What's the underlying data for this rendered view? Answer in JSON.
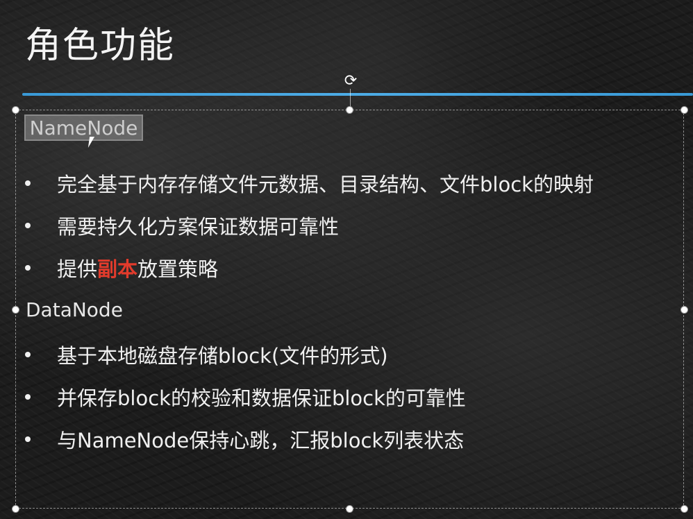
{
  "slide": {
    "title": "角色功能",
    "accent_color": "#4fb3f0",
    "highlight_color": "#e23b2c"
  },
  "namenode": {
    "heading": "NameNode",
    "bullets": [
      {
        "text": "完全基于内存存储文件元数据、目录结构、文件block的映射"
      },
      {
        "text": "需要持久化方案保证数据可靠性"
      },
      {
        "prefix": "提供",
        "highlight": "副本",
        "suffix": "放置策略"
      }
    ]
  },
  "datanode": {
    "heading": "DataNode",
    "bullets": [
      {
        "text": "基于本地磁盘存储block(文件的形式)"
      },
      {
        "text": "并保存block的校验和数据保证block的可靠性"
      },
      {
        "text": "与NameNode保持心跳，汇报block列表状态"
      }
    ]
  },
  "icons": {
    "rotate": "rotate-handle-icon",
    "bullet": "bullet-icon",
    "cursor": "mouse-pointer-icon"
  }
}
